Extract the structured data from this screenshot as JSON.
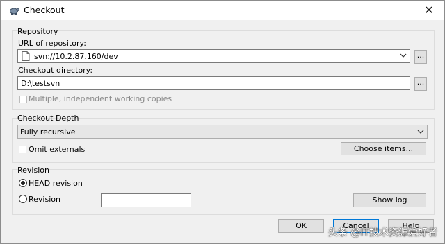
{
  "window": {
    "title": "Checkout",
    "close_glyph": "✕"
  },
  "repository": {
    "group_label": "Repository",
    "url_label": "URL of repository:",
    "url_value": "svn://10.2.87.160/dev",
    "dir_label": "Checkout directory:",
    "dir_value": "D:\\testsvn",
    "browse_label": "...",
    "multiple_label": "Multiple, independent working copies"
  },
  "depth": {
    "group_label": "Checkout Depth",
    "selected": "Fully recursive",
    "omit_label": "Omit externals",
    "choose_label": "Choose items..."
  },
  "revision": {
    "group_label": "Revision",
    "head_label": "HEAD revision",
    "revision_label": "Revision",
    "revision_value": "",
    "showlog_label": "Show log"
  },
  "buttons": {
    "ok": "OK",
    "cancel": "Cancel",
    "help": "Help"
  },
  "watermark": "头条 @IT技术资源爱好者",
  "icons": {
    "app": "tortoise-icon",
    "file": "file-icon",
    "dropdown": "chevron-down-icon"
  }
}
